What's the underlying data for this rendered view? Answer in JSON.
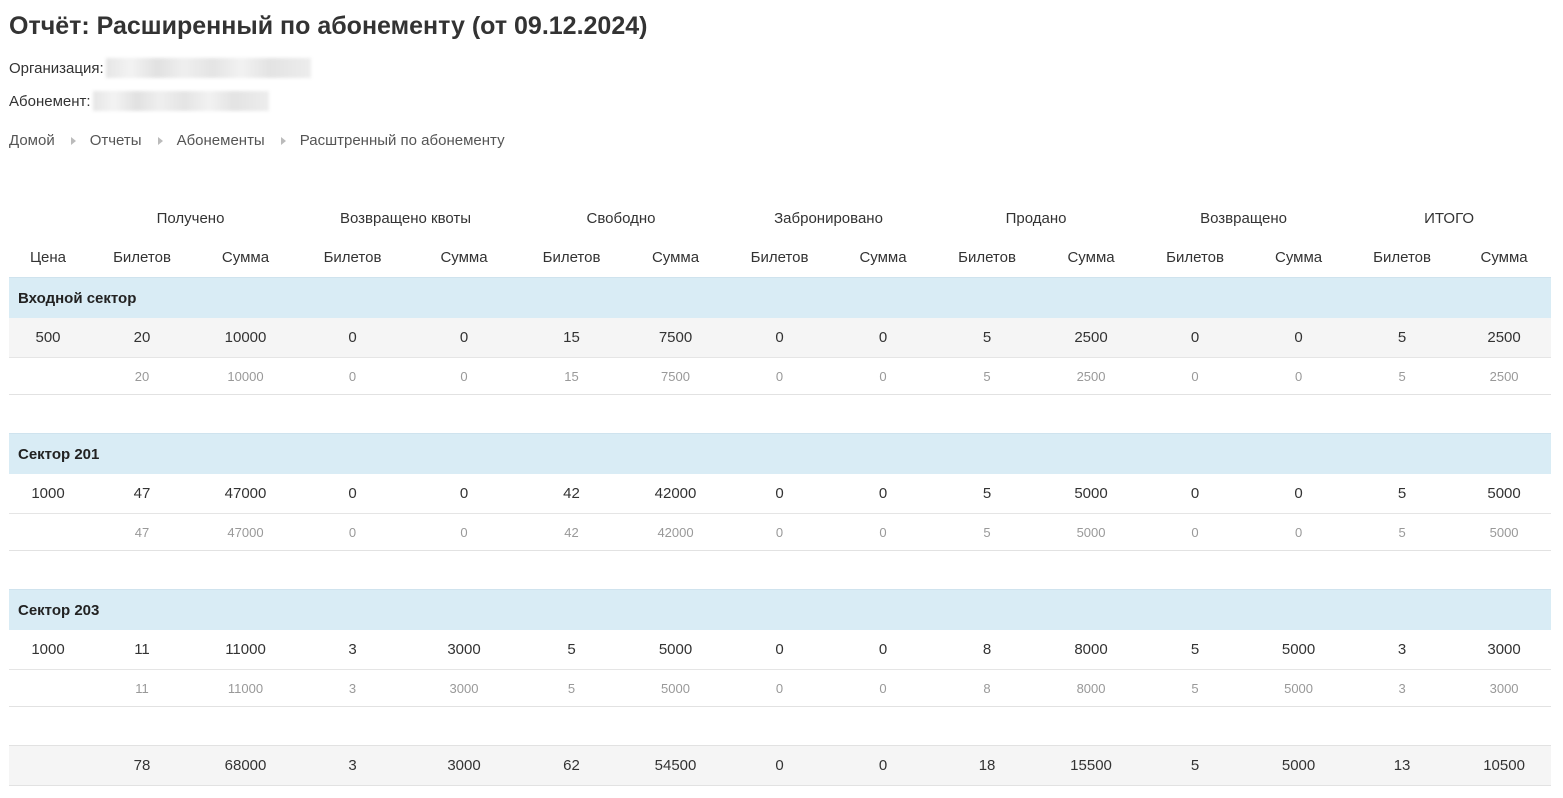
{
  "title": "Отчёт: Расширенный по абонементу (от 09.12.2024)",
  "organization_label": "Организация:",
  "subscription_label": "Абонемент:",
  "breadcrumb": [
    "Домой",
    "Отчеты",
    "Абонементы",
    "Расштренный по абонементу"
  ],
  "table": {
    "groups": [
      "Получено",
      "Возвращено квоты",
      "Свободно",
      "Забронировано",
      "Продано",
      "Возвращено",
      "ИТОГО"
    ],
    "columns": [
      "Цена",
      "Билетов",
      "Сумма",
      "Билетов",
      "Сумма",
      "Билетов",
      "Сумма",
      "Билетов",
      "Сумма",
      "Билетов",
      "Сумма",
      "Билетов",
      "Сумма",
      "Билетов",
      "Сумма"
    ],
    "sectors": [
      {
        "name": "Входной сектор",
        "rows": [
          [
            "500",
            "20",
            "10000",
            "0",
            "0",
            "15",
            "7500",
            "0",
            "0",
            "5",
            "2500",
            "0",
            "0",
            "5",
            "2500"
          ]
        ],
        "subtotal": [
          "",
          "20",
          "10000",
          "0",
          "0",
          "15",
          "7500",
          "0",
          "0",
          "5",
          "2500",
          "0",
          "0",
          "5",
          "2500"
        ]
      },
      {
        "name": "Сектор 201",
        "rows": [
          [
            "1000",
            "47",
            "47000",
            "0",
            "0",
            "42",
            "42000",
            "0",
            "0",
            "5",
            "5000",
            "0",
            "0",
            "5",
            "5000"
          ]
        ],
        "subtotal": [
          "",
          "47",
          "47000",
          "0",
          "0",
          "42",
          "42000",
          "0",
          "0",
          "5",
          "5000",
          "0",
          "0",
          "5",
          "5000"
        ]
      },
      {
        "name": "Сектор 203",
        "rows": [
          [
            "1000",
            "11",
            "11000",
            "3",
            "3000",
            "5",
            "5000",
            "0",
            "0",
            "8",
            "8000",
            "5",
            "5000",
            "3",
            "3000"
          ]
        ],
        "subtotal": [
          "",
          "11",
          "11000",
          "3",
          "3000",
          "5",
          "5000",
          "0",
          "0",
          "8",
          "8000",
          "5",
          "5000",
          "3",
          "3000"
        ]
      }
    ],
    "total": [
      "",
      "78",
      "68000",
      "3",
      "3000",
      "62",
      "54500",
      "0",
      "0",
      "18",
      "15500",
      "5",
      "5000",
      "13",
      "10500"
    ]
  },
  "colors": {
    "sector_background": "#d9ecf5",
    "shaded_row": "#f5f5f5",
    "subtotal_text": "#999999"
  }
}
